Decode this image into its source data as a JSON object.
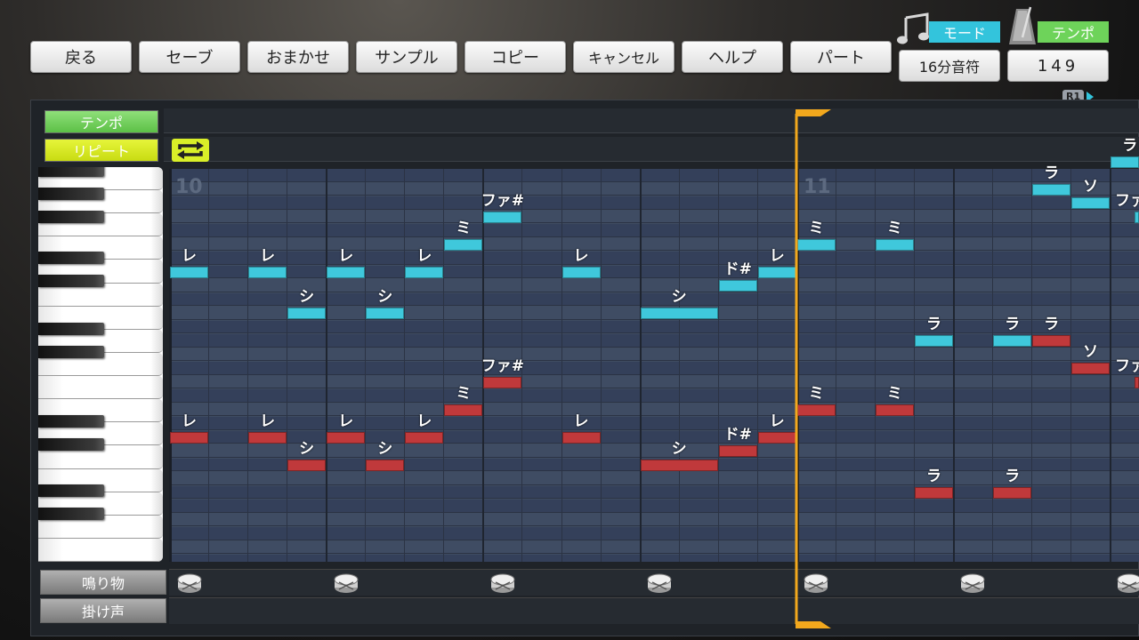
{
  "toolbar": {
    "buttons": [
      "戻る",
      "セーブ",
      "おまかせ",
      "サンプル",
      "コピー",
      "キャンセル",
      "ヘルプ",
      "パート"
    ]
  },
  "mode": {
    "label": "モード",
    "value": "16分音符",
    "icon": "music-note-icon",
    "color": "#33c4dc"
  },
  "tempo": {
    "label": "テンポ",
    "value": "149",
    "icon": "metronome-icon",
    "color": "#6ed35a"
  },
  "r1_hint": "R1",
  "editor": {
    "tempo_row_label": "テンポ",
    "repeat_row_label": "リピート",
    "repeat_icon": "repeat-icon",
    "bars": [
      "10",
      "11"
    ],
    "percussion_label": "鳴り物",
    "voice_label": "掛け声",
    "drum_icon": "drum-icon"
  },
  "notes": {
    "colors": {
      "melody": "#3fc8dc",
      "harmony": "#c0393b"
    },
    "melody": [
      {
        "label": "レ"
      },
      {
        "label": "レ"
      },
      {
        "label": "シ"
      },
      {
        "label": "レ"
      },
      {
        "label": "シ"
      },
      {
        "label": "レ"
      },
      {
        "label": "ミ"
      },
      {
        "label": "ファ#"
      },
      {
        "label": "レ"
      },
      {
        "label": "シ"
      },
      {
        "label": "ド#"
      },
      {
        "label": "レ"
      },
      {
        "label": "ミ"
      },
      {
        "label": "ミ"
      },
      {
        "label": "ラ"
      },
      {
        "label": "ラ"
      },
      {
        "label": "ラ"
      },
      {
        "label": "ラ"
      },
      {
        "label": "ソ"
      },
      {
        "label": "ファ"
      }
    ],
    "harmony": [
      {
        "label": "レ"
      },
      {
        "label": "レ"
      },
      {
        "label": "シ"
      },
      {
        "label": "レ"
      },
      {
        "label": "シ"
      },
      {
        "label": "レ"
      },
      {
        "label": "ミ"
      },
      {
        "label": "ファ#"
      },
      {
        "label": "レ"
      },
      {
        "label": "シ"
      },
      {
        "label": "ド#"
      },
      {
        "label": "レ"
      },
      {
        "label": "ミ"
      },
      {
        "label": "ミ"
      },
      {
        "label": "ラ"
      },
      {
        "label": "ラ"
      },
      {
        "label": "ラ"
      },
      {
        "label": "ソ"
      },
      {
        "label": "ファ"
      }
    ]
  }
}
